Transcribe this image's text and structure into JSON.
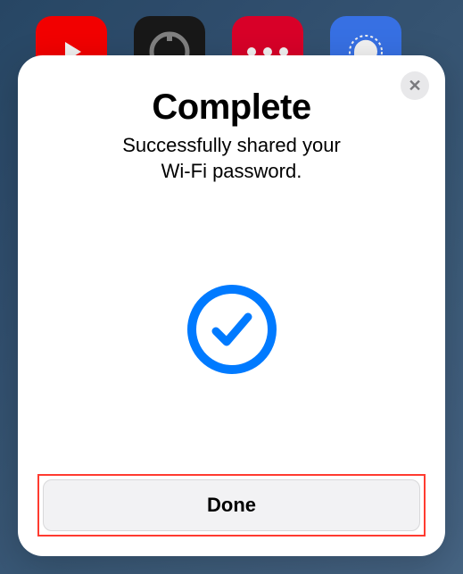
{
  "sheet": {
    "title": "Complete",
    "subtitle_line1": "Successfully shared your",
    "subtitle_line2": "Wi-Fi password.",
    "done_label": "Done"
  },
  "icons": {
    "close": "✕",
    "success": "checkmark-circle"
  },
  "background_apps": [
    {
      "name": "youtube",
      "color": "#ff0000"
    },
    {
      "name": "app-dark",
      "color": "#1a1a1a"
    },
    {
      "name": "app-red-dots",
      "color": "#e4002b"
    },
    {
      "name": "signal",
      "color": "#3a76f0"
    }
  ],
  "highlight": {
    "done_button": true,
    "color": "#ff3b30"
  }
}
